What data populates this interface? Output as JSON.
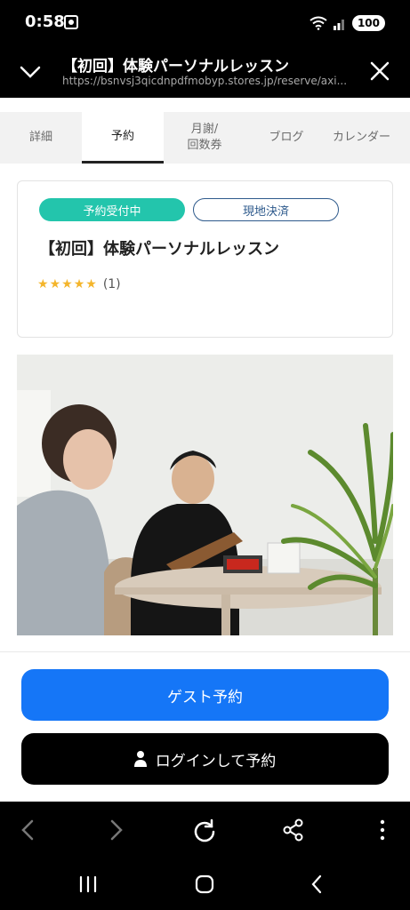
{
  "status_bar": {
    "time": "0:58",
    "wifi_badge": "5",
    "battery": "100"
  },
  "browser_header": {
    "title": "【初回】体験パーソナルレッスン",
    "url": "https://bsnvsj3qicdnpdfmobyp.stores.jp/reserve/axi..."
  },
  "tabs": [
    {
      "label": "詳細"
    },
    {
      "label": "予約"
    },
    {
      "label": "月謝/\n回数券"
    },
    {
      "label": "ブログ"
    },
    {
      "label": "カレンダー"
    }
  ],
  "active_tab": "予約",
  "card": {
    "badge_status": "予約受付中",
    "badge_payment": "現地決済",
    "title": "【初回】体験パーソナルレッスン",
    "rating_stars": 5,
    "rating_count": "(1)"
  },
  "colors": {
    "accent_teal": "#23c5ac",
    "primary_blue": "#1576f7",
    "star": "#f4b52b",
    "outline_blue": "#2e5a8c"
  },
  "buttons": {
    "guest": "ゲスト予約",
    "login": "ログインして予約"
  },
  "icons": {
    "browser_toolbar": [
      "back-icon",
      "forward-icon",
      "reload-icon",
      "share-icon",
      "more-icon"
    ],
    "nav_bar": [
      "recent-apps-icon",
      "home-icon",
      "back-nav-icon"
    ]
  }
}
